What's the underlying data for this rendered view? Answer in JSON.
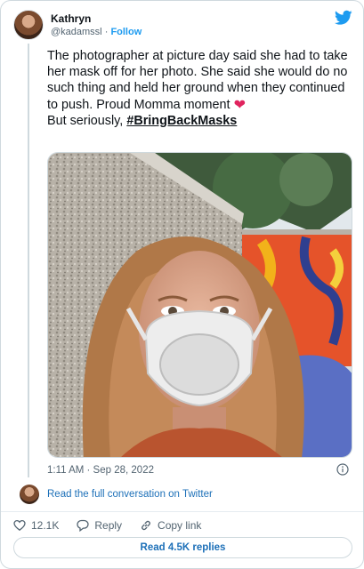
{
  "author": {
    "name": "Kathryn",
    "handle": "@kadamssl",
    "separator": "·",
    "follow_label": "Follow"
  },
  "tweet": {
    "text_main": "The photographer at picture day said she had to take her mask off for her photo. She said she would do no such thing and held her ground when they continued to push. Proud Momma moment",
    "text_line2": "But seriously,",
    "hashtag": "#BringBackMasks",
    "timestamp": "1:11 AM · Sep 28, 2022"
  },
  "conversation_link": "Read the full conversation on Twitter",
  "actions": {
    "like_count": "12.1K",
    "reply_label": "Reply",
    "copy_link_label": "Copy link"
  },
  "read_replies_label": "Read 4.5K replies",
  "colors": {
    "brand": "#1d9bf0",
    "link": "#1d70b8",
    "text": "#0f1419",
    "muted": "#536471",
    "heart": "#e0245e",
    "border": "#cfd9de"
  },
  "icons": [
    "twitter-bird-icon",
    "heart-emoji-icon",
    "info-icon",
    "like-icon",
    "reply-icon",
    "copy-link-icon"
  ]
}
